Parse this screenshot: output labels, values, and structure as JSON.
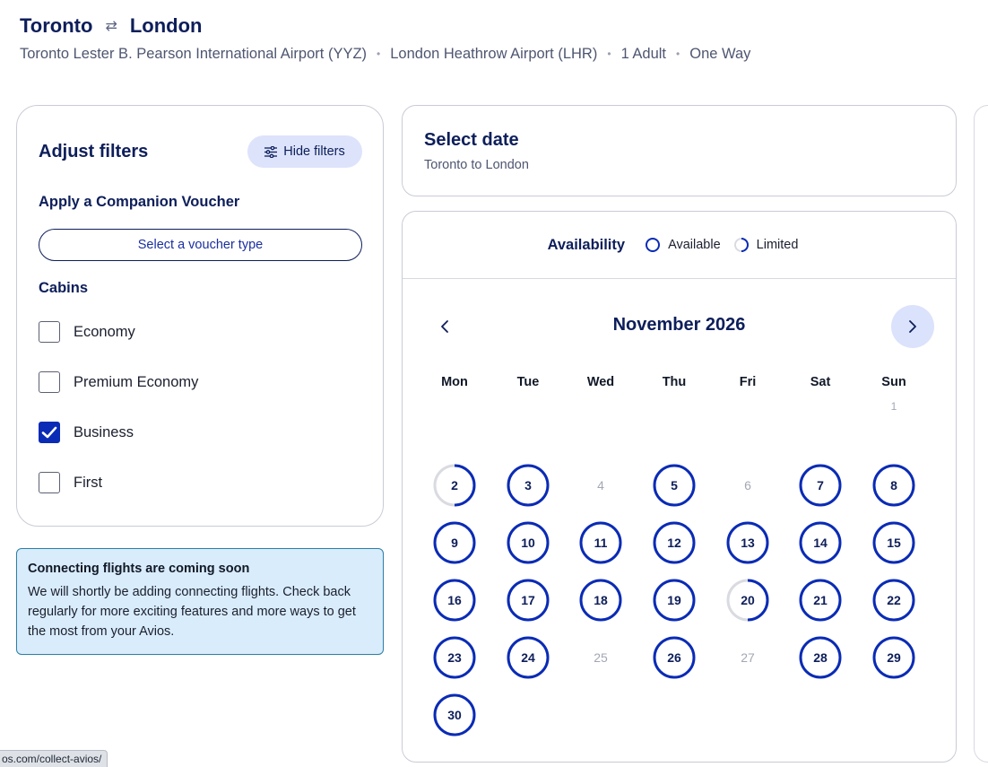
{
  "route": {
    "from_city": "Toronto",
    "to_city": "London",
    "swap_glyph": "⇄",
    "from_airport": "Toronto Lester B. Pearson International Airport (YYZ)",
    "to_airport": "London Heathrow Airport (LHR)",
    "passengers": "1 Adult",
    "trip_type": "One Way",
    "separator": "•"
  },
  "filters": {
    "title": "Adjust filters",
    "hide_label": "Hide filters",
    "companion_label": "Apply a Companion Voucher",
    "voucher_button": "Select a voucher type",
    "cabins_label": "Cabins",
    "cabins": [
      {
        "label": "Economy",
        "checked": false
      },
      {
        "label": "Premium Economy",
        "checked": false
      },
      {
        "label": "Business",
        "checked": true
      },
      {
        "label": "First",
        "checked": false
      }
    ]
  },
  "notice": {
    "title": "Connecting flights are coming soon",
    "body": "We will shortly be adding connecting flights. Check back regularly for more exciting features and more ways to get the most from your Avios."
  },
  "select_date": {
    "title": "Select date",
    "subtitle": "Toronto to London"
  },
  "calendar": {
    "legend_title": "Availability",
    "legend_available": "Available",
    "legend_limited": "Limited",
    "month_label": "November 2026",
    "weekdays": [
      "Mon",
      "Tue",
      "Wed",
      "Thu",
      "Fri",
      "Sat",
      "Sun"
    ],
    "first_weekday_index": 6,
    "days": [
      {
        "d": "1",
        "s": "none"
      },
      {
        "d": "2",
        "s": "limited"
      },
      {
        "d": "3",
        "s": "available"
      },
      {
        "d": "4",
        "s": "none"
      },
      {
        "d": "5",
        "s": "available"
      },
      {
        "d": "6",
        "s": "none"
      },
      {
        "d": "7",
        "s": "available"
      },
      {
        "d": "8",
        "s": "available"
      },
      {
        "d": "9",
        "s": "available"
      },
      {
        "d": "10",
        "s": "available"
      },
      {
        "d": "11",
        "s": "available"
      },
      {
        "d": "12",
        "s": "available"
      },
      {
        "d": "13",
        "s": "available"
      },
      {
        "d": "14",
        "s": "available"
      },
      {
        "d": "15",
        "s": "available"
      },
      {
        "d": "16",
        "s": "available"
      },
      {
        "d": "17",
        "s": "available"
      },
      {
        "d": "18",
        "s": "available"
      },
      {
        "d": "19",
        "s": "available"
      },
      {
        "d": "20",
        "s": "limited"
      },
      {
        "d": "21",
        "s": "available"
      },
      {
        "d": "22",
        "s": "available"
      },
      {
        "d": "23",
        "s": "available"
      },
      {
        "d": "24",
        "s": "available"
      },
      {
        "d": "25",
        "s": "none"
      },
      {
        "d": "26",
        "s": "available"
      },
      {
        "d": "27",
        "s": "none"
      },
      {
        "d": "28",
        "s": "available"
      },
      {
        "d": "29",
        "s": "available"
      },
      {
        "d": "30",
        "s": "available"
      }
    ]
  },
  "status_bar": {
    "url": "os.com/collect-avios/"
  },
  "colors": {
    "navy": "#0d1e5a",
    "ring_blue": "#0a2bb5",
    "ring_grey": "#d9dbe1",
    "pill_bg": "#dde3fb",
    "notice_bg": "#d9ecfb"
  },
  "icons": {
    "hide_filters": "sliders-icon",
    "prev_month": "chevron-left-icon",
    "next_month": "chevron-right-icon",
    "checkbox_checked": "checkmark-icon"
  }
}
